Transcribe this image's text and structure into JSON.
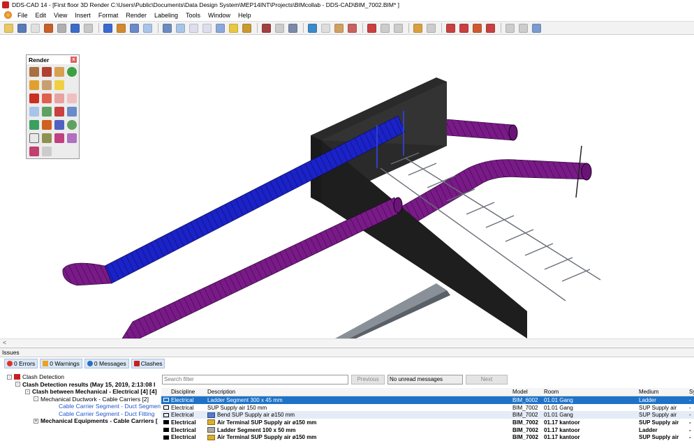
{
  "window": {
    "title": "DDS-CAD 14 - [First floor  3D  Render  C:\\Users\\Public\\Documents\\Data Design System\\MEP14INT\\Projects\\BIMcollab - DDS-CAD\\BIM_7002.BIM* ]"
  },
  "menu": [
    "File",
    "Edit",
    "View",
    "Insert",
    "Format",
    "Render",
    "Labeling",
    "Tools",
    "Window",
    "Help"
  ],
  "render_panel": {
    "title": "Render",
    "close": "x"
  },
  "scroll_indicator": "<",
  "issues": {
    "header": "Issues",
    "tabs": [
      {
        "label": "0 Errors",
        "icon": "error-icon",
        "color": "#d9352b"
      },
      {
        "label": "0 Warnings",
        "icon": "warning-icon",
        "color": "#f0a020"
      },
      {
        "label": "0 Messages",
        "icon": "info-icon",
        "color": "#2a6fc4"
      },
      {
        "label": "Clashes",
        "icon": "clash-icon",
        "color": "#c62020"
      }
    ],
    "tree": [
      {
        "label": "Clash Detection",
        "level": 0,
        "toggle": "-",
        "style": ""
      },
      {
        "label": "Clash Detection results (May 15, 2019, 2:13:08 I",
        "level": 1,
        "toggle": "-",
        "style": "bold"
      },
      {
        "label": "Clash between Mechanical - Electrical [4] [4]",
        "level": 2,
        "toggle": "-",
        "style": "bold"
      },
      {
        "label": "Mechanical Ductwork - Cable Carriers [2]",
        "level": 3,
        "toggle": "-",
        "style": ""
      },
      {
        "label": "Cable Carrier Segment - Duct Segment",
        "level": 4,
        "toggle": "",
        "style": "link"
      },
      {
        "label": "Cable Carrier Segment - Duct Fitting",
        "level": 4,
        "toggle": "",
        "style": "link"
      },
      {
        "label": "Mechanical Equipments - Cable Carriers [",
        "level": 3,
        "toggle": "+",
        "style": "bold"
      }
    ],
    "search_placeholder": "Search filter",
    "previous_label": "Previous",
    "next_label": "Next",
    "unread_label": "No unread messages",
    "columns": [
      "Discipline",
      "Description",
      "Model",
      "Room",
      "Medium",
      "Sy"
    ],
    "rows": [
      {
        "discipline": "Electrical",
        "description": "Ladder Segment 300 x 45 mm",
        "model": "BIM_6002",
        "room": "01.01 Gang",
        "medium": "Ladder",
        "sy": "-",
        "state": "sel",
        "icon": ""
      },
      {
        "discipline": "Electrical",
        "description": "SUP Supply air 150 mm",
        "model": "BIM_7002",
        "room": "01.01 Gang",
        "medium": "SUP Supply air",
        "sy": "-",
        "state": "",
        "icon": ""
      },
      {
        "discipline": "Electrical",
        "description": "Bend SUP Supply air ø150 mm",
        "model": "BIM_7002",
        "room": "01.01 Gang",
        "medium": "SUP Supply air",
        "sy": "-",
        "state": "alt",
        "icon": "bend-icon"
      },
      {
        "discipline": "Electrical",
        "description": "Air Terminal SUP Supply air ø150 mm",
        "model": "BIM_7002",
        "room": "01.17 kantoor",
        "medium": "SUP Supply air",
        "sy": "-",
        "state": "bold",
        "icon": "terminal-icon"
      },
      {
        "discipline": "Electrical",
        "description": "Ladder Segment  100 x 50 mm",
        "model": "BIM_7002",
        "room": "01.17 kantoor",
        "medium": "Ladder",
        "sy": "-",
        "state": "bold",
        "icon": "ladder-icon"
      },
      {
        "discipline": "Electrical",
        "description": "Air Terminal SUP Supply air ø150 mm",
        "model": "BIM_7002",
        "room": "01.17 kantoor",
        "medium": "SUP Supply air",
        "sy": "-",
        "state": "bold",
        "icon": "terminal-icon"
      }
    ]
  },
  "colors": {
    "duct_purple": "#7a1a88",
    "duct_blue": "#1a22c8",
    "wall": "#2a2a2a",
    "selection": "#1e73c8"
  }
}
